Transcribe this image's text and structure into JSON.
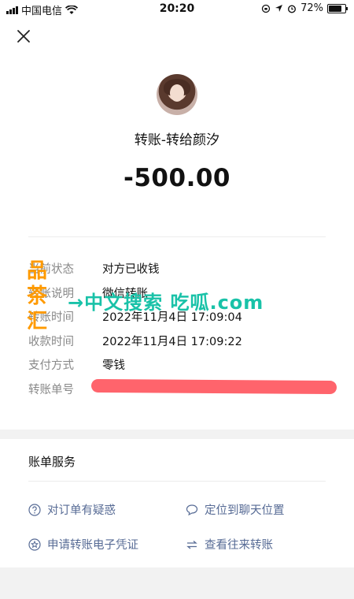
{
  "status_bar": {
    "carrier": "中国电信",
    "time": "20:20",
    "battery": "72%"
  },
  "payee": {
    "title": "转账-转给颜汐"
  },
  "amount": "-500.00",
  "details": [
    {
      "label": "当前状态",
      "value": "对方已收钱"
    },
    {
      "label": "转账说明",
      "value": "微信转账"
    },
    {
      "label": "转账时间",
      "value": "2022年11月4日 17:09:04"
    },
    {
      "label": "收款时间",
      "value": "2022年11月4日 17:09:22"
    },
    {
      "label": "支付方式",
      "value": "零钱"
    },
    {
      "label": "转账单号",
      "value": ""
    }
  ],
  "watermark": {
    "vertical": [
      "品",
      "茶",
      "汇"
    ],
    "horizontal": "→中文搜索 吃呱.com"
  },
  "services": {
    "title": "账单服务",
    "items": [
      {
        "label": "对订单有疑惑",
        "icon": "question-circle-icon"
      },
      {
        "label": "定位到聊天位置",
        "icon": "chat-bubble-icon"
      },
      {
        "label": "申请转账电子凭证",
        "icon": "star-circle-icon"
      },
      {
        "label": "查看往来转账",
        "icon": "transfer-arrows-icon"
      }
    ]
  },
  "colors": {
    "link": "#576b95",
    "redaction": "#ff5c64",
    "watermark_orange": "#ff9a00",
    "watermark_teal": "#19c2a8"
  }
}
